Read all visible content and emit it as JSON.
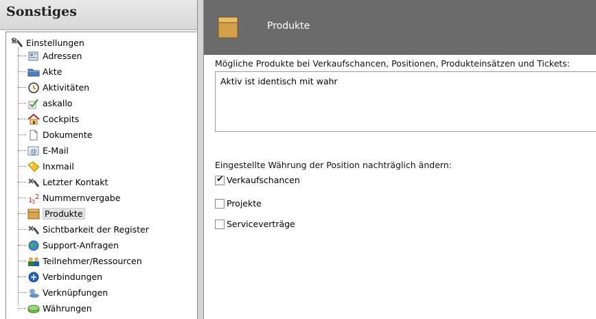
{
  "sidebar": {
    "title": "Sonstiges",
    "root_label": "Einstellungen",
    "items": [
      {
        "label": "Adressen",
        "icon": "address-book-icon"
      },
      {
        "label": "Akte",
        "icon": "folder-icon"
      },
      {
        "label": "Aktivitäten",
        "icon": "clock-icon"
      },
      {
        "label": "askallo",
        "icon": "checkmark-icon"
      },
      {
        "label": "Cockpits",
        "icon": "house-icon"
      },
      {
        "label": "Dokumente",
        "icon": "document-icon"
      },
      {
        "label": "E-Mail",
        "icon": "email-icon"
      },
      {
        "label": "Inxmail",
        "icon": "tag-icon"
      },
      {
        "label": "Letzter Kontakt",
        "icon": "tools-icon"
      },
      {
        "label": "Nummernvergabe",
        "icon": "numbering-icon"
      },
      {
        "label": "Produkte",
        "icon": "product-box-icon",
        "selected": true
      },
      {
        "label": "Sichtbarkeit der Register",
        "icon": "tools-icon"
      },
      {
        "label": "Support-Anfragen",
        "icon": "globe-icon"
      },
      {
        "label": "Teilnehmer/Ressourcen",
        "icon": "participants-icon"
      },
      {
        "label": "Verbindungen",
        "icon": "connections-icon"
      },
      {
        "label": "Verknüpfungen",
        "icon": "links-icon"
      },
      {
        "label": "Währungen",
        "icon": "currency-icon"
      }
    ]
  },
  "main": {
    "header_title": "Produkte",
    "products_label": "Mögliche Produkte bei Verkaufschancen, Positionen, Produkteinsätzen und Tickets:",
    "products_value": "Aktiv ist identisch mit wahr",
    "currency_label": "Eingestellte Währung der Position nachträglich ändern:",
    "checkboxes": [
      {
        "label": "Verkaufschancen",
        "checked": true
      },
      {
        "label": "Projekte",
        "checked": false
      },
      {
        "label": "Serviceverträge",
        "checked": false
      }
    ]
  },
  "colors": {
    "header_bg": "#6b6b6b",
    "selection_bg": "#e3e3e3"
  }
}
